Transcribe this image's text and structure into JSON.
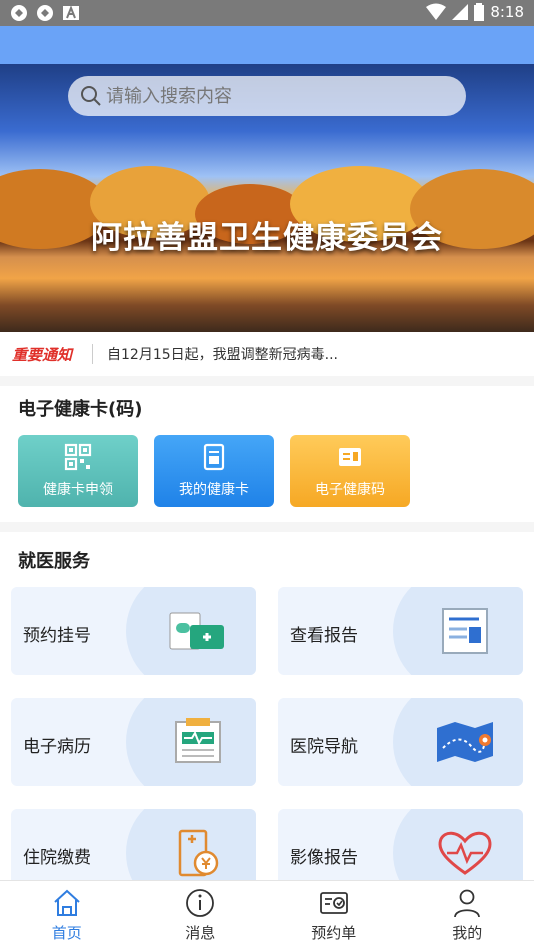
{
  "status_bar": {
    "time": "8:18",
    "left_icons": [
      "sync-icon",
      "sync-icon",
      "a-icon"
    ],
    "right_icons": [
      "wifi-icon",
      "signal-icon",
      "battery-icon"
    ]
  },
  "search": {
    "placeholder": "请输入搜索内容"
  },
  "banner": {
    "title": "阿拉善盟卫生健康委员会"
  },
  "notice": {
    "tag": "重要通知",
    "text": "自12月15日起，我盟调整新冠病毒..."
  },
  "health_card": {
    "title": "电子健康卡(码)",
    "buttons": [
      {
        "label": "健康卡申领",
        "icon": "qr-code-icon",
        "color": "#5fc1bd"
      },
      {
        "label": "我的健康卡",
        "icon": "card-icon",
        "color": "#2f8df0"
      },
      {
        "label": "电子健康码",
        "icon": "id-card-icon",
        "color": "#f9b838"
      }
    ]
  },
  "medical": {
    "title": "就医服务",
    "items": [
      {
        "label": "预约挂号",
        "icon": "medical-kit-icon"
      },
      {
        "label": "查看报告",
        "icon": "report-icon"
      },
      {
        "label": "电子病历",
        "icon": "medical-record-icon"
      },
      {
        "label": "医院导航",
        "icon": "map-icon"
      },
      {
        "label": "住院缴费",
        "icon": "payment-icon"
      },
      {
        "label": "影像报告",
        "icon": "heart-rate-icon"
      }
    ]
  },
  "tabs": [
    {
      "label": "首页",
      "icon": "home-icon",
      "active": true
    },
    {
      "label": "消息",
      "icon": "info-icon"
    },
    {
      "label": "预约单",
      "icon": "appointment-icon"
    },
    {
      "label": "我的",
      "icon": "user-icon"
    }
  ],
  "colors": {
    "accent": "#2f7de0",
    "appbar": "#6aa3f7",
    "notice_tag": "#e0302a"
  }
}
